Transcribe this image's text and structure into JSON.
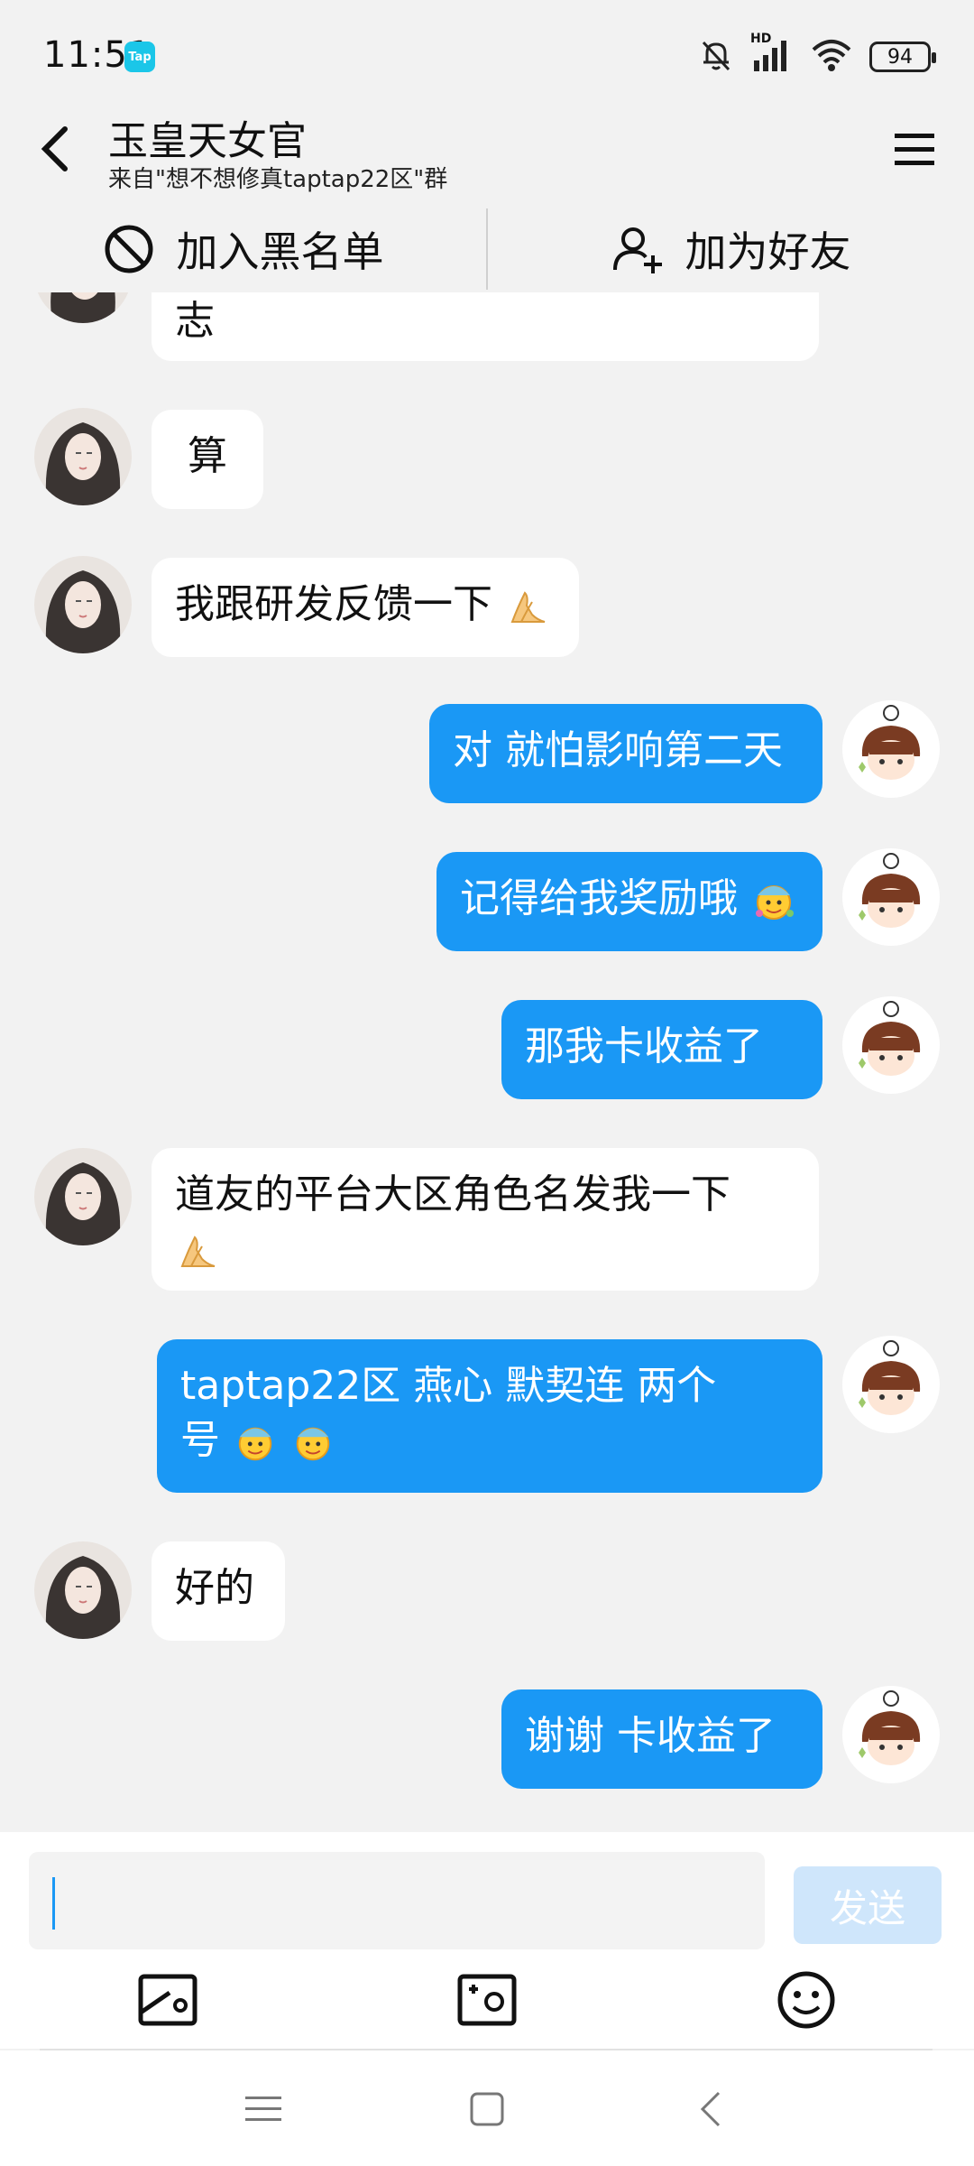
{
  "status": {
    "time": "11:51",
    "app_badge": "Tap",
    "network_label": "HD",
    "battery": "94"
  },
  "header": {
    "title": "玉皇天女官",
    "subtitle": "来自\"想不想修真taptap22区\"群"
  },
  "actions": {
    "block_label": "加入黑名单",
    "add_friend_label": "加为好友"
  },
  "messages": [
    {
      "side": "in",
      "text": "志"
    },
    {
      "side": "in",
      "text": "算"
    },
    {
      "side": "in",
      "text": "我跟研发反馈一下"
    },
    {
      "side": "out",
      "text": "对 就怕影响第二天"
    },
    {
      "side": "out",
      "text": "记得给我奖励哦"
    },
    {
      "side": "out",
      "text": "那我卡收益了"
    },
    {
      "side": "in",
      "line1": "道友的平台大区角色名发我一下",
      "line2": ""
    },
    {
      "side": "out",
      "line1": "taptap22区  燕心  默契连    两个",
      "line2": "号"
    },
    {
      "side": "in",
      "text": "好的"
    },
    {
      "side": "out",
      "text": "谢谢  卡收益了"
    }
  ],
  "input": {
    "value": "",
    "send_label": "发送"
  },
  "icons": {
    "back": "back-arrow-icon",
    "menu": "hamburger-menu-icon",
    "block": "block-icon",
    "add_friend": "add-friend-icon",
    "image": "image-icon",
    "camera": "camera-icon",
    "emoji": "emoji-icon"
  },
  "colors": {
    "outgoing_bubble": "#1a98f5",
    "incoming_bubble": "#ffffff",
    "send_disabled": "#cfe6fb",
    "background": "#f2f2f2"
  }
}
